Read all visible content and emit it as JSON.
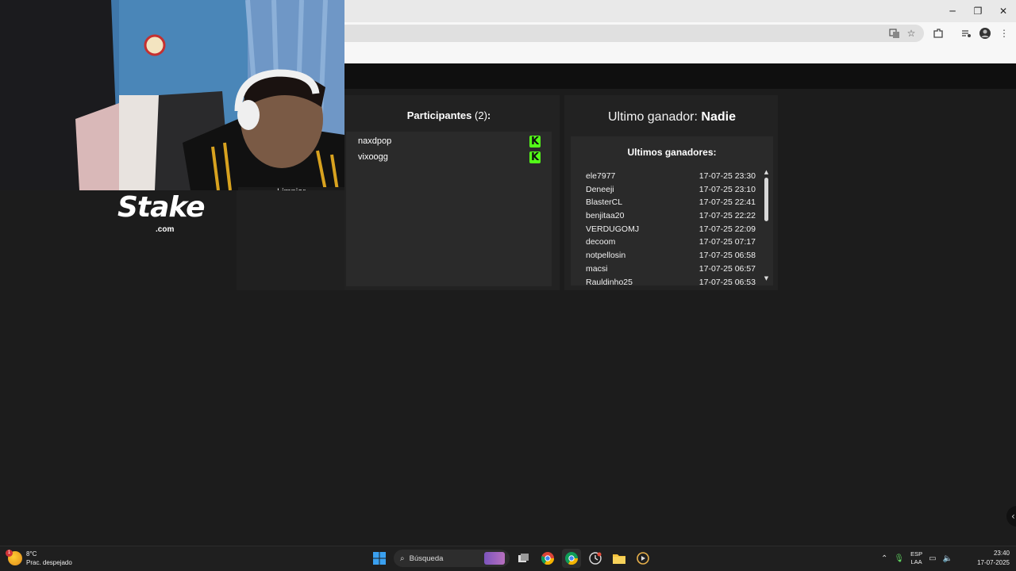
{
  "browser": {
    "window_controls": {
      "minimize": "─",
      "maximize": "❐",
      "close": "✕"
    },
    "toolbar_icons": [
      "translate-icon",
      "star-icon",
      "extensions-icon",
      "media-icon",
      "profile-icon",
      "menu-icon"
    ]
  },
  "overlay": {
    "limpiar_label": "Limpiar",
    "stake_logo_text": "Stake",
    "stake_logo_sub": ".com"
  },
  "participants": {
    "title": "Participantes",
    "count": "(2)",
    "colon": ":",
    "items": [
      {
        "name": "naxdpop",
        "platform": "K"
      },
      {
        "name": "vixoogg",
        "platform": "K"
      }
    ]
  },
  "winners": {
    "last_winner_label": "Ultimo ganador:",
    "last_winner_name": "Nadie",
    "list_title": "Ultimos ganadores:",
    "rows": [
      {
        "name": "ele7977",
        "date": "17-07-25 23:30"
      },
      {
        "name": "Deneeji",
        "date": "17-07-25 23:10"
      },
      {
        "name": "BlasterCL",
        "date": "17-07-25 22:41"
      },
      {
        "name": "benjitaa20",
        "date": "17-07-25 22:22"
      },
      {
        "name": "VERDUGOMJ",
        "date": "17-07-25 22:09"
      },
      {
        "name": "decoom",
        "date": "17-07-25 07:17"
      },
      {
        "name": "notpellosin",
        "date": "17-07-25 06:58"
      },
      {
        "name": "macsi",
        "date": "17-07-25 06:57"
      },
      {
        "name": "Rauldinho25",
        "date": "17-07-25 06:53"
      }
    ]
  },
  "taskbar": {
    "weather_temp": "8°C",
    "weather_desc": "Prac. despejado",
    "weather_badge": "1",
    "search_placeholder": "Búsqueda",
    "lang_top": "ESP",
    "lang_bottom": "LAA",
    "time": "23:40",
    "date": "17-07-2025"
  },
  "colors": {
    "kick_green": "#53fc18",
    "panel_bg": "#222222",
    "page_bg": "#1c1c1c"
  }
}
